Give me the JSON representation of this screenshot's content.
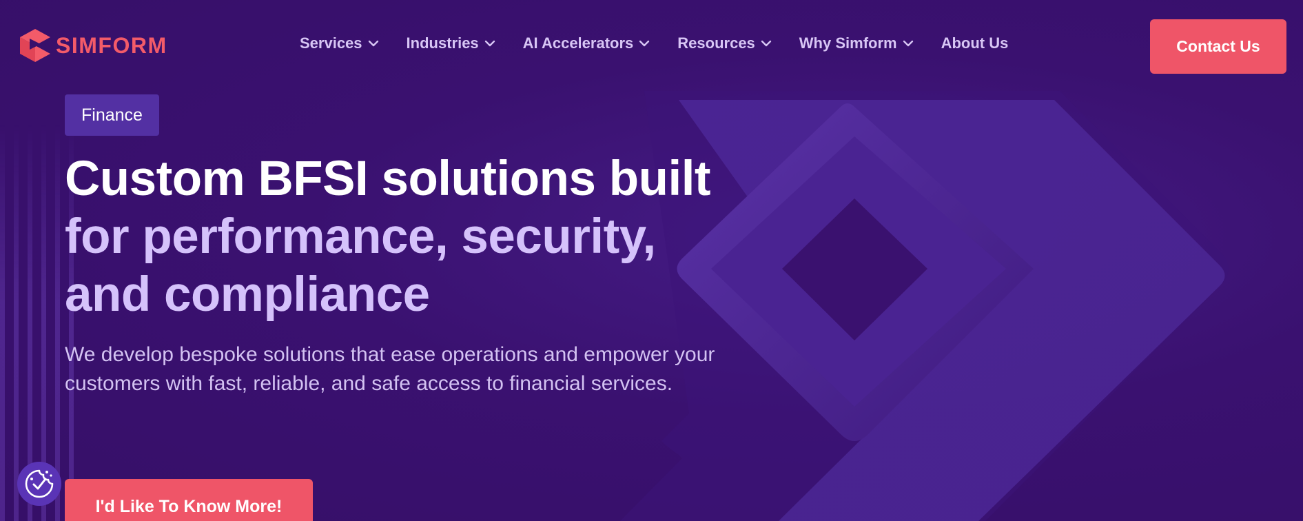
{
  "brand": {
    "name": "SIMFORM",
    "logo_icon": "simform-logo-icon",
    "accent_color": "#ef5568",
    "background_color": "#38106c"
  },
  "nav": {
    "items": [
      {
        "label": "Services",
        "has_dropdown": true
      },
      {
        "label": "Industries",
        "has_dropdown": true
      },
      {
        "label": "AI Accelerators",
        "has_dropdown": true
      },
      {
        "label": "Resources",
        "has_dropdown": true
      },
      {
        "label": "Why Simform",
        "has_dropdown": true
      },
      {
        "label": "About Us",
        "has_dropdown": false
      }
    ],
    "contact_label": "Contact Us"
  },
  "hero": {
    "tag": "Finance",
    "headline_line1": "Custom BFSI solutions built",
    "headline_line2": "for performance, security,",
    "headline_line3": "and compliance",
    "description": "We develop bespoke solutions that ease operations and empower your customers with fast, reliable, and safe access to financial services.",
    "cta_label": "I'd Like To Know More!"
  },
  "widgets": {
    "cookie_icon": "cookie-consent-icon"
  }
}
